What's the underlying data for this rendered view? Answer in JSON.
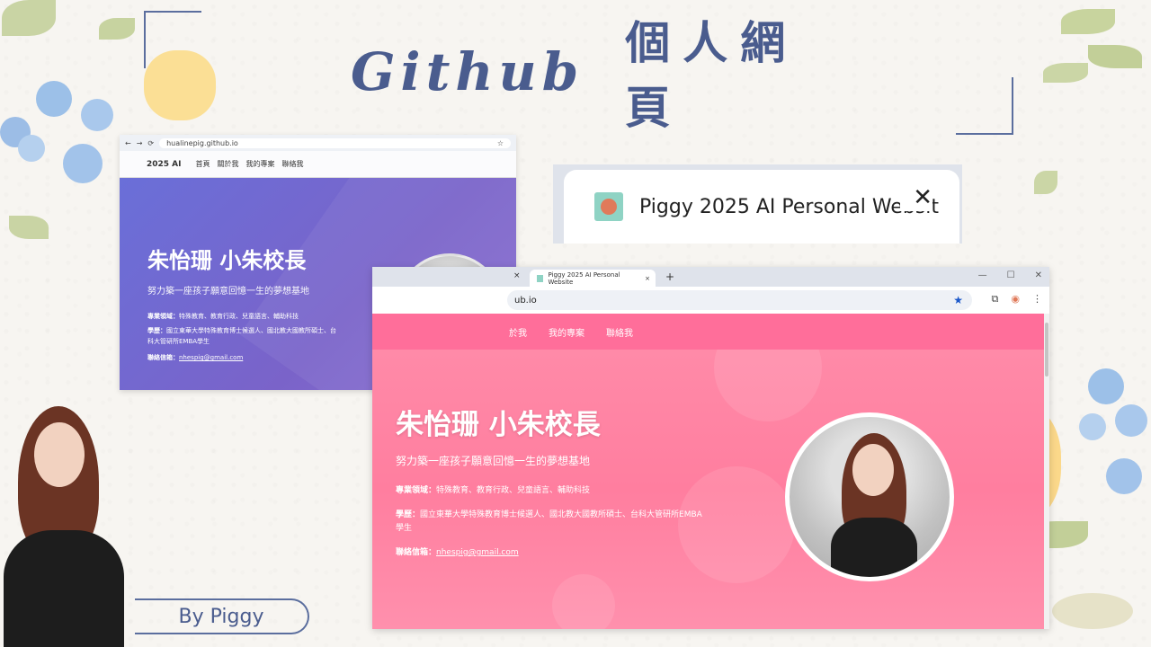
{
  "slide": {
    "title_en": "Github",
    "title_zh": "個人網頁",
    "byline": "By Piggy"
  },
  "browser_small": {
    "url": "hualinepig.github.io",
    "brand": "2025 AI",
    "nav": [
      "首頁",
      "關於我",
      "我的專案",
      "聯絡我"
    ],
    "name": "朱怡珊 小朱校長",
    "tagline": "努力築一座孩子願意回憶一生的夢想基地",
    "expertise_label": "專業領域：",
    "expertise": "特殊教育、教育行政、兒童語言、輔助科技",
    "education_label": "學歷：",
    "education": "國立東華大學特殊教育博士候選人、國北教大國教所碩士、台科大管研所EMBA學生",
    "contact_label": "聯絡信箱：",
    "email": "nhespig@gmail.com"
  },
  "tab_zoom": {
    "title": "Piggy 2025 AI Personal Websit",
    "close": "✕"
  },
  "browser_large": {
    "tab_title": "Piggy 2025 AI Personal Website",
    "tab_close": "×",
    "new_tab": "+",
    "prev_tab_close": "×",
    "url": "ub.io",
    "window_controls": [
      "—",
      "☐",
      "✕"
    ],
    "nav": [
      "於我",
      "我的專案",
      "聯絡我"
    ],
    "name": "朱怡珊 小朱校長",
    "tagline": "努力築一座孩子願意回憶一生的夢想基地",
    "expertise_label": "專業領域：",
    "expertise": "特殊教育、教育行政、兒童語言、輔助科技",
    "education_label": "學歷：",
    "education": "國立東華大學特殊教育博士候選人、國北教大國教所碩士、台科大管研所EMBA學生",
    "contact_label": "聯絡信箱：",
    "email": "nhespig@gmail.com"
  },
  "colors": {
    "accent": "#4a5c8e",
    "hero_purple": "#7a63c9",
    "hero_pink": "#ff7e9f",
    "nav_pink": "#ff6e9a"
  }
}
